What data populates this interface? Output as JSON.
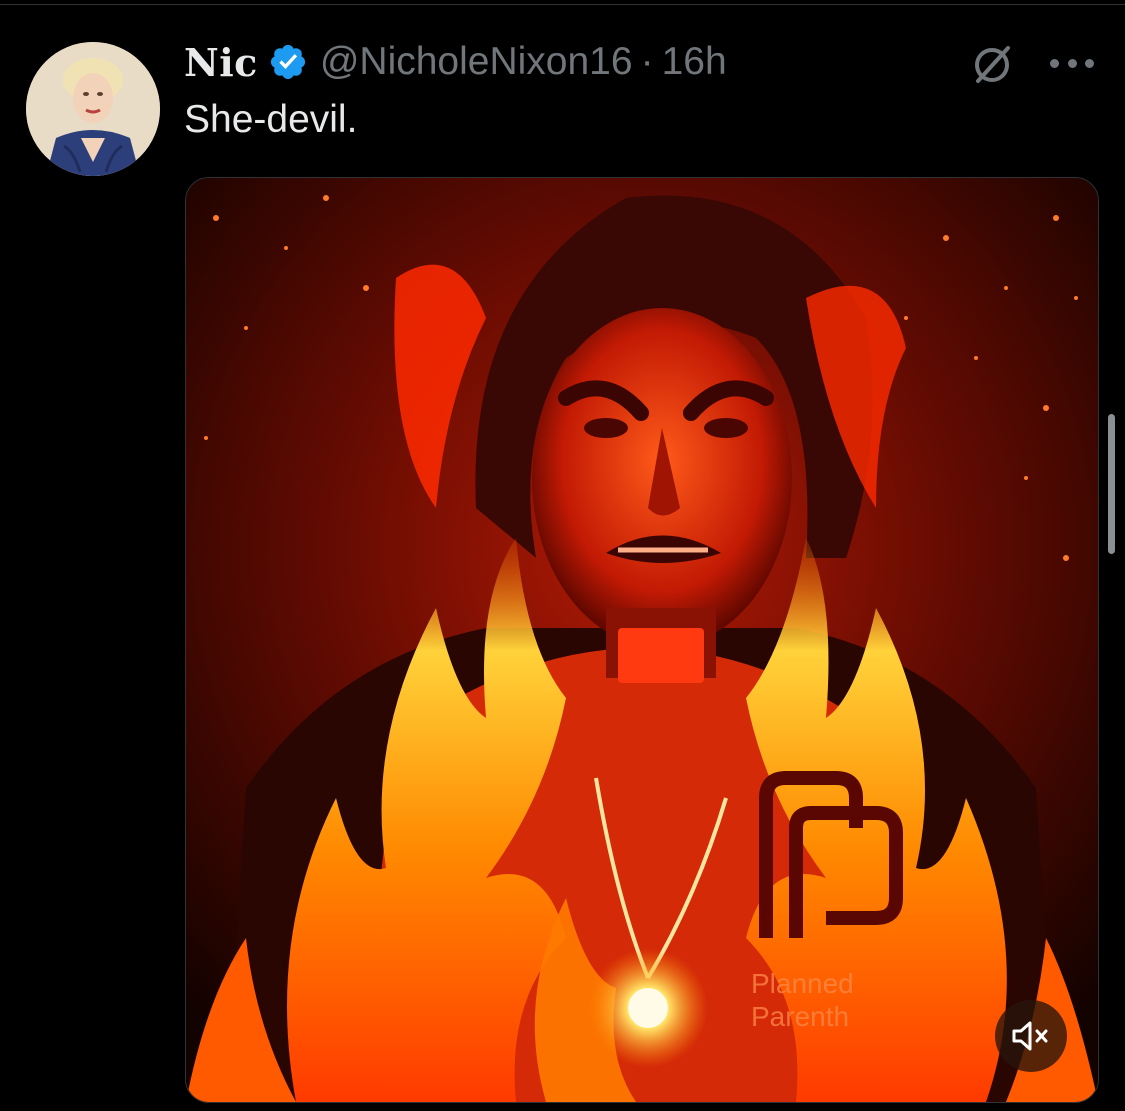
{
  "tweet": {
    "author": {
      "display_name": "Nic",
      "verified": true,
      "handle": "@NicholeNixon16",
      "separator": "·",
      "timestamp": "16h"
    },
    "text": "She-devil.",
    "media": {
      "type": "video",
      "logo_text_line1": "Planned",
      "logo_text_line2": "Parenth",
      "muted": true
    }
  },
  "icons": {
    "verified": "verified-badge-icon",
    "grok": "grok-icon",
    "more": "more-options-icon",
    "mute": "speaker-muted-icon"
  },
  "colors": {
    "background": "#000000",
    "primary_text": "#e7e9ea",
    "secondary_text": "#71767b",
    "verified_blue": "#1d9bf0",
    "border": "#2f3336"
  }
}
